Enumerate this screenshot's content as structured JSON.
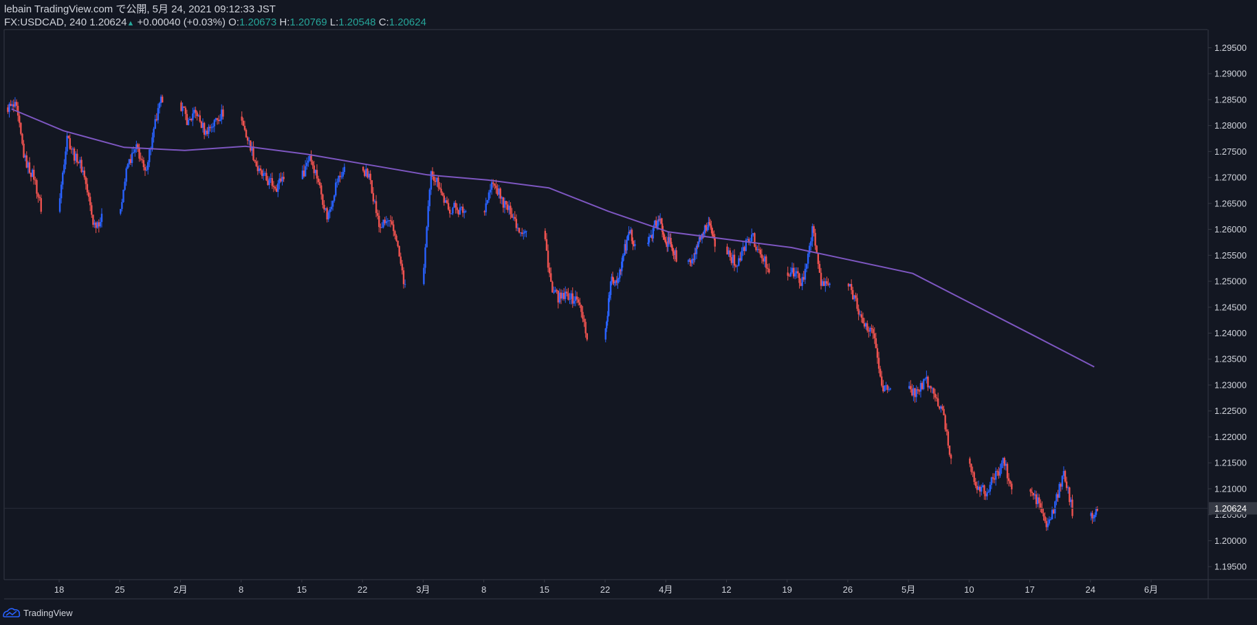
{
  "header": {
    "publisher": "lebain TradingView.com で公開, 5月 24, 2021 09:12:33 JST",
    "symbol": "FX:USDCAD, 240",
    "last": "1.20624",
    "change": "+0.00040 (+0.03%)",
    "open_label": "O:",
    "open": "1.20673",
    "high_label": "H:",
    "high": "1.20769",
    "low_label": "L:",
    "low": "1.20548",
    "close_label": "C:",
    "close": "1.20624"
  },
  "footer": {
    "brand": "TradingView"
  },
  "colors": {
    "background": "#131722",
    "up": "#2962ff",
    "down": "#ef5350",
    "ma": "#7e57c2",
    "text": "#d1d4dc",
    "axis_line": "#363a45",
    "price_label_bg": "#363a45"
  },
  "chart_data": {
    "type": "candlestick",
    "symbol": "USDCAD",
    "timeframe": "240",
    "ylim": [
      1.1925,
      1.2985
    ],
    "yticks": [
      1.195,
      1.2,
      1.205,
      1.21,
      1.215,
      1.22,
      1.225,
      1.23,
      1.235,
      1.24,
      1.245,
      1.25,
      1.255,
      1.26,
      1.265,
      1.27,
      1.275,
      1.28,
      1.285,
      1.29,
      1.295
    ],
    "current_price": 1.20624,
    "current_price_label": "1.20624",
    "grid": false,
    "xticks": [
      {
        "label": "18",
        "date": "2021-01-18"
      },
      {
        "label": "25",
        "date": "2021-01-25"
      },
      {
        "label": "2月",
        "date": "2021-02-01"
      },
      {
        "label": "8",
        "date": "2021-02-08"
      },
      {
        "label": "15",
        "date": "2021-02-15"
      },
      {
        "label": "22",
        "date": "2021-02-22"
      },
      {
        "label": "3月",
        "date": "2021-03-01"
      },
      {
        "label": "8",
        "date": "2021-03-08"
      },
      {
        "label": "15",
        "date": "2021-03-15"
      },
      {
        "label": "22",
        "date": "2021-03-22"
      },
      {
        "label": "4月",
        "date": "2021-04-01"
      },
      {
        "label": "12",
        "date": "2021-04-12"
      },
      {
        "label": "19",
        "date": "2021-04-19"
      },
      {
        "label": "26",
        "date": "2021-04-26"
      },
      {
        "label": "5月",
        "date": "2021-05-03"
      },
      {
        "label": "10",
        "date": "2021-05-10"
      },
      {
        "label": "17",
        "date": "2021-05-17"
      },
      {
        "label": "24",
        "date": "2021-05-24"
      },
      {
        "label": "6月",
        "date": "2021-06-01"
      }
    ],
    "close_series": [
      {
        "date": "2021-01-12",
        "close": 1.2835
      },
      {
        "date": "2021-01-13",
        "close": 1.2745
      },
      {
        "date": "2021-01-14",
        "close": 1.2705
      },
      {
        "date": "2021-01-15",
        "close": 1.264
      },
      {
        "date": "2021-01-18",
        "close": 1.2785
      },
      {
        "date": "2021-01-19",
        "close": 1.2735
      },
      {
        "date": "2021-01-20",
        "close": 1.2705
      },
      {
        "date": "2021-01-21",
        "close": 1.2615
      },
      {
        "date": "2021-01-22",
        "close": 1.262
      },
      {
        "date": "2021-01-25",
        "close": 1.2725
      },
      {
        "date": "2021-01-26",
        "close": 1.2755
      },
      {
        "date": "2021-01-27",
        "close": 1.2705
      },
      {
        "date": "2021-01-28",
        "close": 1.2785
      },
      {
        "date": "2021-01-29",
        "close": 1.2855
      },
      {
        "date": "2021-02-01",
        "close": 1.2805
      },
      {
        "date": "2021-02-02",
        "close": 1.2825
      },
      {
        "date": "2021-02-03",
        "close": 1.2785
      },
      {
        "date": "2021-02-04",
        "close": 1.2805
      },
      {
        "date": "2021-02-05",
        "close": 1.2825
      },
      {
        "date": "2021-02-08",
        "close": 1.2765
      },
      {
        "date": "2021-02-09",
        "close": 1.2715
      },
      {
        "date": "2021-02-10",
        "close": 1.2695
      },
      {
        "date": "2021-02-11",
        "close": 1.2685
      },
      {
        "date": "2021-02-12",
        "close": 1.2705
      },
      {
        "date": "2021-02-15",
        "close": 1.2745
      },
      {
        "date": "2021-02-16",
        "close": 1.2695
      },
      {
        "date": "2021-02-17",
        "close": 1.2625
      },
      {
        "date": "2021-02-18",
        "close": 1.2685
      },
      {
        "date": "2021-02-19",
        "close": 1.2715
      },
      {
        "date": "2021-02-22",
        "close": 1.2695
      },
      {
        "date": "2021-02-23",
        "close": 1.2605
      },
      {
        "date": "2021-02-24",
        "close": 1.2615
      },
      {
        "date": "2021-02-25",
        "close": 1.2585
      },
      {
        "date": "2021-02-26",
        "close": 1.2485
      },
      {
        "date": "2021-03-01",
        "close": 1.2705
      },
      {
        "date": "2021-03-02",
        "close": 1.2685
      },
      {
        "date": "2021-03-03",
        "close": 1.2635
      },
      {
        "date": "2021-03-04",
        "close": 1.2645
      },
      {
        "date": "2021-03-05",
        "close": 1.2635
      },
      {
        "date": "2021-03-08",
        "close": 1.2685
      },
      {
        "date": "2021-03-09",
        "close": 1.2665
      },
      {
        "date": "2021-03-10",
        "close": 1.2635
      },
      {
        "date": "2021-03-11",
        "close": 1.2605
      },
      {
        "date": "2021-03-12",
        "close": 1.2595
      },
      {
        "date": "2021-03-15",
        "close": 1.2475
      },
      {
        "date": "2021-03-16",
        "close": 1.2465
      },
      {
        "date": "2021-03-17",
        "close": 1.2475
      },
      {
        "date": "2021-03-18",
        "close": 1.2465
      },
      {
        "date": "2021-03-19",
        "close": 1.2395
      },
      {
        "date": "2021-03-22",
        "close": 1.2495
      },
      {
        "date": "2021-03-23",
        "close": 1.2505
      },
      {
        "date": "2021-03-24",
        "close": 1.2545
      },
      {
        "date": "2021-03-25",
        "close": 1.2585
      },
      {
        "date": "2021-03-26",
        "close": 1.2575
      },
      {
        "date": "2021-03-29",
        "close": 1.2595
      },
      {
        "date": "2021-03-30",
        "close": 1.2615
      },
      {
        "date": "2021-03-31",
        "close": 1.2585
      },
      {
        "date": "2021-04-01",
        "close": 1.2575
      },
      {
        "date": "2021-04-02",
        "close": 1.2545
      },
      {
        "date": "2021-04-05",
        "close": 1.2535
      },
      {
        "date": "2021-04-06",
        "close": 1.2565
      },
      {
        "date": "2021-04-07",
        "close": 1.2585
      },
      {
        "date": "2021-04-08",
        "close": 1.2615
      },
      {
        "date": "2021-04-09",
        "close": 1.2575
      },
      {
        "date": "2021-04-12",
        "close": 1.2535
      },
      {
        "date": "2021-04-13",
        "close": 1.2555
      },
      {
        "date": "2021-04-14",
        "close": 1.2585
      },
      {
        "date": "2021-04-15",
        "close": 1.2545
      },
      {
        "date": "2021-04-16",
        "close": 1.2525
      },
      {
        "date": "2021-04-19",
        "close": 1.2515
      },
      {
        "date": "2021-04-20",
        "close": 1.2495
      },
      {
        "date": "2021-04-21",
        "close": 1.2605
      },
      {
        "date": "2021-04-22",
        "close": 1.2495
      },
      {
        "date": "2021-04-23",
        "close": 1.2495
      },
      {
        "date": "2021-04-26",
        "close": 1.2465
      },
      {
        "date": "2021-04-27",
        "close": 1.2405
      },
      {
        "date": "2021-04-28",
        "close": 1.2405
      },
      {
        "date": "2021-04-29",
        "close": 1.2305
      },
      {
        "date": "2021-04-30",
        "close": 1.2285
      },
      {
        "date": "2021-05-03",
        "close": 1.2285
      },
      {
        "date": "2021-05-04",
        "close": 1.2305
      },
      {
        "date": "2021-05-05",
        "close": 1.2285
      },
      {
        "date": "2021-05-06",
        "close": 1.2245
      },
      {
        "date": "2021-05-07",
        "close": 1.2155
      },
      {
        "date": "2021-05-10",
        "close": 1.2105
      },
      {
        "date": "2021-05-11",
        "close": 1.2095
      },
      {
        "date": "2021-05-12",
        "close": 1.2125
      },
      {
        "date": "2021-05-13",
        "close": 1.2155
      },
      {
        "date": "2021-05-14",
        "close": 1.2095
      },
      {
        "date": "2021-05-17",
        "close": 1.2075
      },
      {
        "date": "2021-05-18",
        "close": 1.2025
      },
      {
        "date": "2021-05-19",
        "close": 1.2065
      },
      {
        "date": "2021-05-20",
        "close": 1.2125
      },
      {
        "date": "2021-05-21",
        "close": 1.2055
      },
      {
        "date": "2021-05-24",
        "close": 1.20624
      }
    ],
    "moving_average": [
      {
        "date": "2021-01-12",
        "value": 1.2832
      },
      {
        "date": "2021-01-18",
        "value": 1.279
      },
      {
        "date": "2021-01-25",
        "value": 1.2758
      },
      {
        "date": "2021-02-01",
        "value": 1.2752
      },
      {
        "date": "2021-02-08",
        "value": 1.276
      },
      {
        "date": "2021-02-15",
        "value": 1.2745
      },
      {
        "date": "2021-02-22",
        "value": 1.2725
      },
      {
        "date": "2021-03-01",
        "value": 1.2705
      },
      {
        "date": "2021-03-08",
        "value": 1.2695
      },
      {
        "date": "2021-03-15",
        "value": 1.268
      },
      {
        "date": "2021-03-22",
        "value": 1.2635
      },
      {
        "date": "2021-04-01",
        "value": 1.2595
      },
      {
        "date": "2021-04-12",
        "value": 1.258
      },
      {
        "date": "2021-04-19",
        "value": 1.2565
      },
      {
        "date": "2021-04-26",
        "value": 1.254
      },
      {
        "date": "2021-05-03",
        "value": 1.2515
      },
      {
        "date": "2021-05-10",
        "value": 1.2455
      },
      {
        "date": "2021-05-17",
        "value": 1.2395
      },
      {
        "date": "2021-05-24",
        "value": 1.2335
      }
    ]
  }
}
